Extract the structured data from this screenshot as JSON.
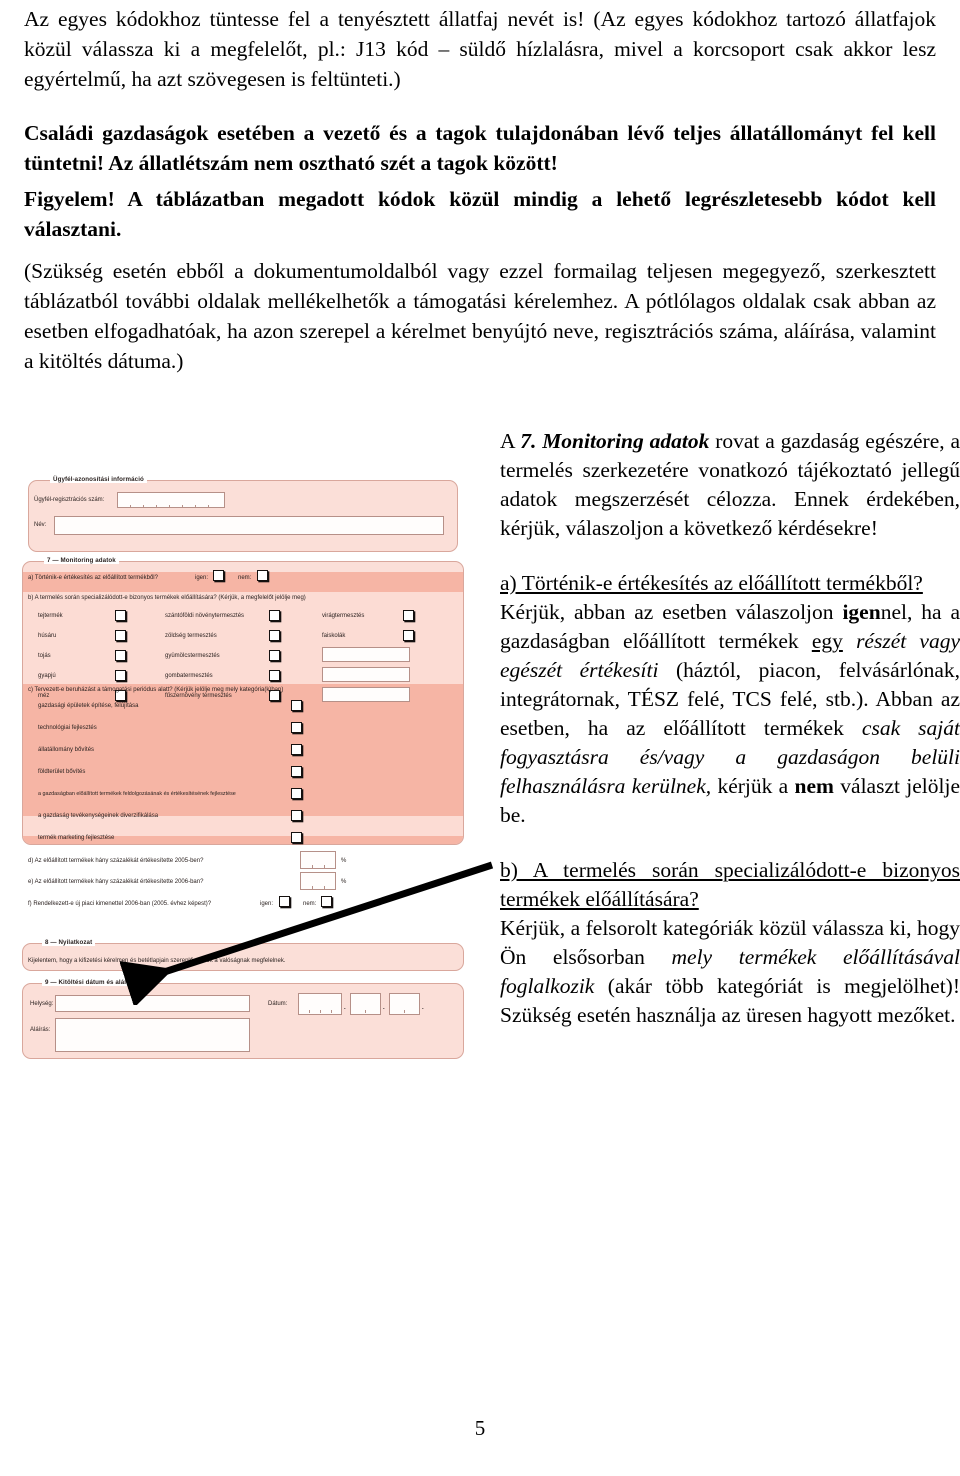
{
  "page_number": "5",
  "body": {
    "para1_parts": [
      {
        "t": "Az egyes kódokhoz tüntesse fel a tenyésztett állatfaj nevét is! (Az egyes kódokhoz tartozó állatfajok közül válassza ki a megfelelőt, pl.: J13 kód – süldő hízlalásra, mivel a korcsoport csak akkor lesz egyértelmű, ha azt szövegesen is feltünteti.)",
        "s": "normal"
      }
    ],
    "para2_bold": "Családi gazdaságok esetében a vezető és a tagok tulajdonában lévő teljes állatállományt fel kell tüntetni! Az állatlétszám nem osztható szét a tagok között!",
    "para3_bold": "Figyelem! A táblázatban megadott kódok közül mindig a lehető legrészletesebb kódot kell választani.",
    "para4": "(Szükség esetén ebből a dokumentumoldalból vagy ezzel formailag teljesen megegyező, szerkesztett táblázatból további oldalak mellékelhetők a támogatási kérelemhez. A pótlólagos oldalak csak abban az esetben elfogadhatóak, ha azon szerepel a kérelmet benyújtó neve, regisztrációs száma, aláírása, valamint a kitöltés dátuma.)"
  },
  "right_column": {
    "intro": {
      "lead": "A ",
      "section_num": "7.",
      "section_title": "Monitoring adatok",
      "rest": " rovat a gazdaság egészére, a termelés szerkezetére vonatkozó tájékoztató jellegű adatok megszerzését célozza. Ennek érdekében, kérjük, válaszoljon a következő kérdésekre!"
    },
    "qa": {
      "heading": "a) Történik-e értékesítés az előállított termékből?",
      "t1": "Kérjük, abban az esetben válaszoljon ",
      "b1": "igen",
      "t2": "nel, ha a gazdaságban előállított termékek ",
      "u1": "egy",
      "t3": " ",
      "i1": "részét vagy egészét értékesíti",
      "t4": " (háztól, piacon, felvásárlónak, integrátornak, TÉSZ felé, TCS felé, stb.). Abban az esetben, ha az előállított termékek ",
      "i2": "csak saját fogyasztásra és/vagy a gazdaságon belüli felhasználásra kerülnek,",
      "t5": " kérjük a ",
      "b2": "nem",
      "t6": " választ jelölje be."
    },
    "qb": {
      "heading": "b) A termelés során specializálódott-e bizonyos termékek előállítására?",
      "t1": "Kérjük, a felsorolt kategóriák közül válassza ki, hogy Ön elsősorban ",
      "i1": "mely termékek előállításával foglalkozik",
      "t2": " (akár több kategóriát is megjelölhet)! Szükség esetén használja az üresen hagyott mezőket."
    }
  },
  "form": {
    "section_client": {
      "legend": "Ügyfél-azonosítási információ",
      "reg_label": "Ügyfél-regisztrációs szám:",
      "name_label": "Név:"
    },
    "section_monitoring": {
      "legend": "7 — Monitoring adatok",
      "qa_text": "a) Történik-e értékesítés az előállított termékből?",
      "yes_label": "igen:",
      "no_label": "nem:",
      "qb_text": "b) A termelés során specializálódott-e bizonyos termékek előállítására? (Kérjük, a megfelelőt jelölje meg)",
      "col1": [
        "tejtermék",
        "húsáru",
        "tojás",
        "gyapjú",
        "méz"
      ],
      "col2": [
        "szántóföldi növénytermesztés",
        "zöldség termesztés",
        "gyümölcstermesztés",
        "gombatermesztés",
        "fűszernövény termesztés"
      ],
      "col3": [
        "virágtermesztés",
        "faiskolák"
      ],
      "qc_text": "c) Tervezett-e beruházást a támogatási periódus alatt? (Kérjük jelölje meg mely kategória(k)ban)",
      "qc_items": [
        "gazdasági épületek építése, felújítása",
        "technológiai fejlesztés",
        "állatállomány bővítés",
        "földterület bővítés",
        "a gazdaságban előállított termékek feldolgozásának és értékesítésének fejlesztése",
        "a gazdaság tevékenységeinek diverzifikálása",
        "termék marketing fejlesztése"
      ],
      "qd_text": "d) Az előállított termékek hány százalékát értékesítette 2005-ben?",
      "qe_text": "e) Az előállított termékek hány százalékát értékesítette 2006-ban?",
      "percent_symbol": "%",
      "qf_text": "f) Rendelkezett-e új piaci kimenettel 2006-ban (2005. évhez képest)?"
    },
    "section_declaration": {
      "legend": "8 — Nyilatkozat",
      "text": "Kijelentem, hogy a kifizetési kérelmen és betétlapjain szereplő adatok a valóságnak megfelelnek."
    },
    "section_signature": {
      "legend": "9 — Kitöltési dátum és aláírás",
      "place_label": "Helység:",
      "signature_label": "Aláírás:",
      "date_label": "Dátum:",
      "date_sep": "."
    }
  },
  "colors": {
    "form_fill": "#fbdfd8",
    "band_dark": "#f6b5a5",
    "band_light": "#fcdcd4",
    "border": "#d9a79c",
    "arrow": "#000000"
  }
}
